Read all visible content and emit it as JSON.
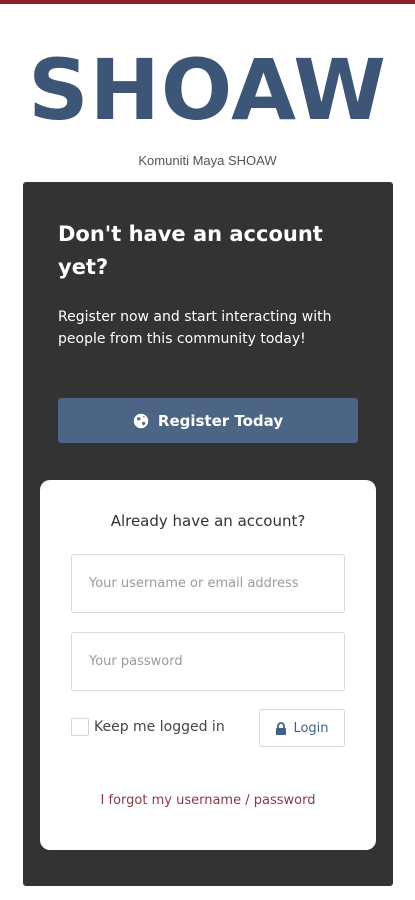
{
  "header": {
    "logo_text": "SHOAW",
    "tagline": "Komuniti Maya SHOAW",
    "accent_color": "#8e1f2b",
    "logo_color": "#3d5677"
  },
  "register": {
    "title": "Don't have an account yet?",
    "text": "Register now and start interacting with people from this community today!",
    "button_label": "Register Today",
    "button_icon": "globe-icon",
    "button_color": "#4c6584"
  },
  "login": {
    "title": "Already have an account?",
    "username_placeholder": "Your username or email address",
    "username_value": "",
    "password_placeholder": "Your password",
    "password_value": "",
    "remember_label": "Keep me logged in",
    "remember_checked": false,
    "button_label": "Login",
    "button_icon": "lock-icon",
    "forgot_link": "I forgot my username / password"
  }
}
